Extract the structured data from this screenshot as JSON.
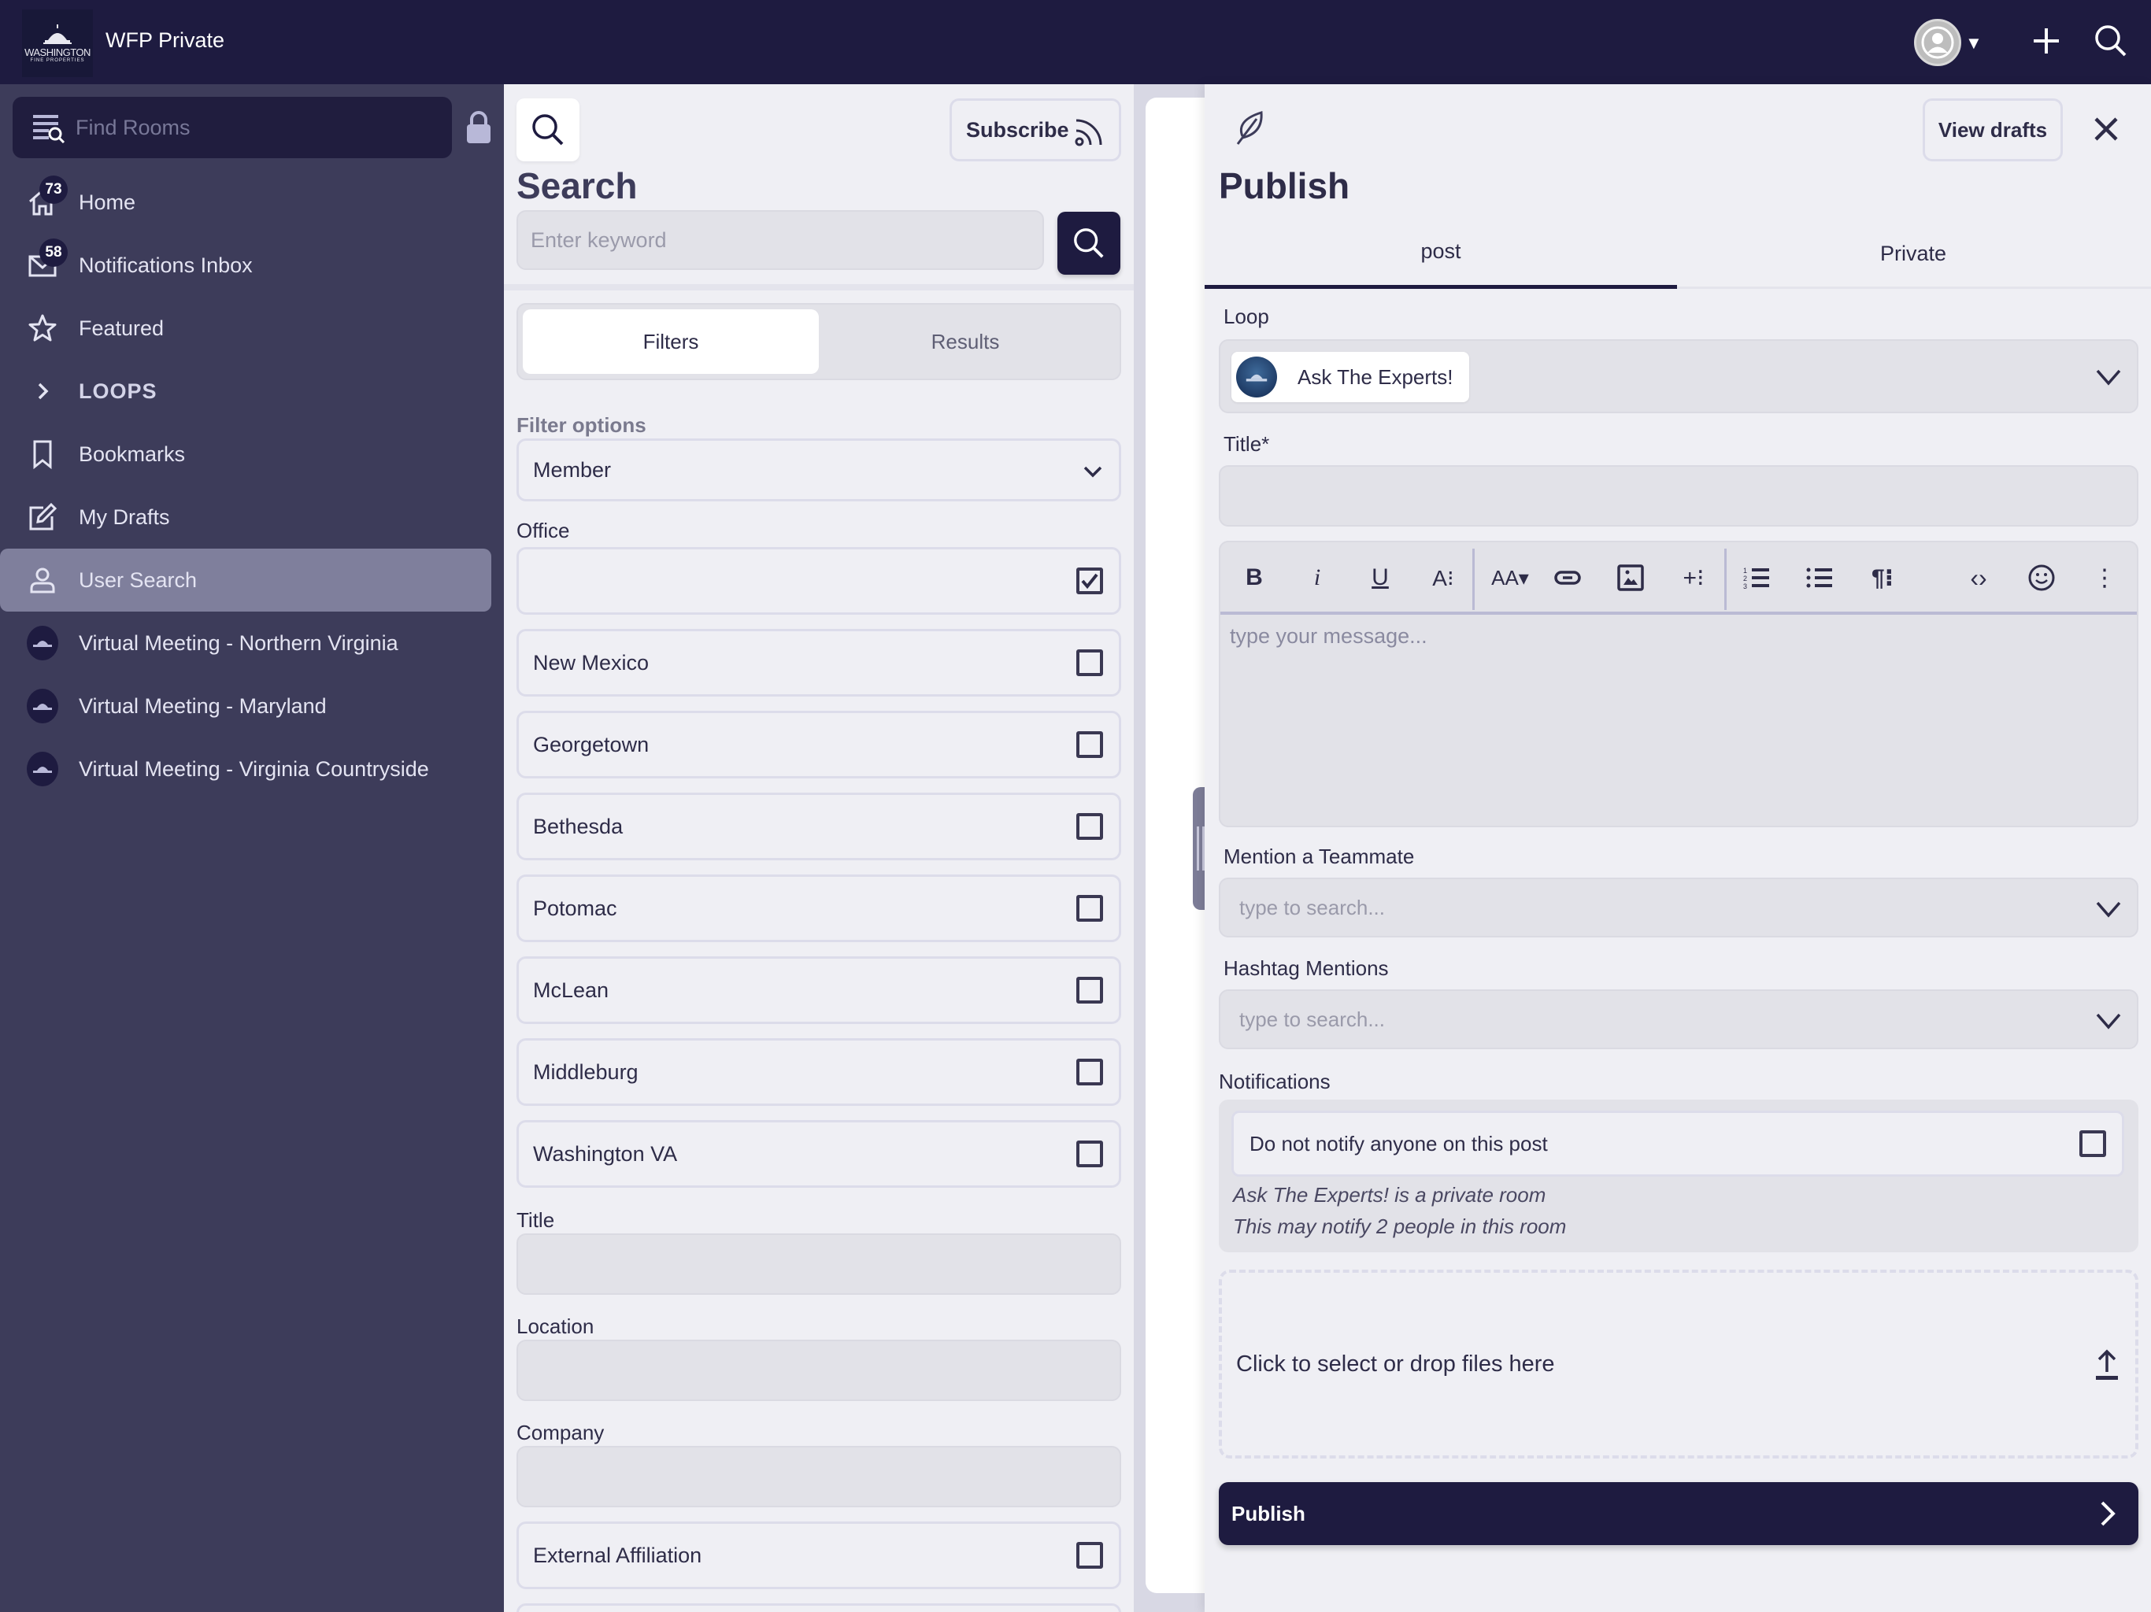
{
  "app": {
    "title": "WFP Private",
    "logo": {
      "line1": "WASHINGTON",
      "line2": "FINE PROPERTIES"
    },
    "actions": {
      "avatar": "user-avatar",
      "add": "plus-icon",
      "search": "search-icon"
    }
  },
  "sidebar": {
    "find_rooms_placeholder": "Find Rooms",
    "items": [
      {
        "label": "Home",
        "icon": "home-icon",
        "badge": "73"
      },
      {
        "label": "Notifications Inbox",
        "icon": "mail-icon",
        "badge": "58"
      },
      {
        "label": "Featured",
        "icon": "star-icon"
      },
      {
        "label": "LOOPS",
        "icon": "chevron-right-icon"
      },
      {
        "label": "Bookmarks",
        "icon": "bookmark-icon"
      },
      {
        "label": "My Drafts",
        "icon": "edit-icon"
      },
      {
        "label": "User Search",
        "icon": "user-icon",
        "active": true
      },
      {
        "label": "Virtual Meeting - Northern Virginia",
        "icon": "room-avatar"
      },
      {
        "label": "Virtual Meeting - Maryland",
        "icon": "room-avatar"
      },
      {
        "label": "Virtual Meeting - Virginia Countryside",
        "icon": "room-avatar"
      }
    ]
  },
  "search": {
    "subscribe_label": "Subscribe",
    "title": "Search",
    "keyword_placeholder": "Enter keyword",
    "keyword_value": "",
    "tabs": [
      {
        "label": "Filters",
        "active": true
      },
      {
        "label": "Results",
        "active": false
      }
    ],
    "filter_options_label": "Filter options",
    "filter_options_value": "Member",
    "office_label": "Office",
    "office_options": [
      {
        "label": "",
        "checked": true
      },
      {
        "label": "New Mexico",
        "checked": false
      },
      {
        "label": "Georgetown",
        "checked": false
      },
      {
        "label": "Bethesda",
        "checked": false
      },
      {
        "label": "Potomac",
        "checked": false
      },
      {
        "label": "McLean",
        "checked": false
      },
      {
        "label": "Middleburg",
        "checked": false
      },
      {
        "label": "Washington VA",
        "checked": false
      }
    ],
    "title_label": "Title",
    "title_value": "",
    "location_label": "Location",
    "location_value": "",
    "company_label": "Company",
    "company_value": "",
    "external_affiliation_label": "External Affiliation",
    "external_affiliation_checked": false
  },
  "publish": {
    "view_drafts_label": "View drafts",
    "title": "Publish",
    "tabs": [
      {
        "label": "post",
        "active": true
      },
      {
        "label": "Private",
        "active": false
      }
    ],
    "loop_label": "Loop",
    "loop_value": "Ask The Experts!",
    "title_label": "Title*",
    "title_value": "",
    "toolbar": [
      {
        "name": "bold",
        "glyph": "B"
      },
      {
        "name": "italic",
        "glyph": "i"
      },
      {
        "name": "underline",
        "glyph": "U"
      },
      {
        "name": "text-style",
        "glyph": "A⁝"
      },
      {
        "name": "font-size",
        "glyph": "AA▾"
      },
      {
        "name": "link",
        "glyph": "⊂⊃"
      },
      {
        "name": "image",
        "glyph": "▣"
      },
      {
        "name": "insert",
        "glyph": "+⁝"
      },
      {
        "name": "ordered-list",
        "glyph": "≡"
      },
      {
        "name": "bullet-list",
        "glyph": "☰"
      },
      {
        "name": "paragraph",
        "glyph": "¶⁝"
      },
      {
        "name": "code",
        "glyph": "‹›"
      },
      {
        "name": "emoji",
        "glyph": "☺"
      },
      {
        "name": "more",
        "glyph": "⋮"
      }
    ],
    "message_placeholder": "type your message...",
    "mention_label": "Mention a Teammate",
    "mention_placeholder": "type to search...",
    "hashtag_label": "Hashtag Mentions",
    "hashtag_placeholder": "type to search...",
    "notifications_label": "Notifications",
    "do_not_notify_label": "Do not notify anyone on this post",
    "do_not_notify_checked": false,
    "notes": [
      "Ask The Experts! is a private room",
      "This may notify 2 people in this room"
    ],
    "dropzone_label": "Click to select or drop files here",
    "publish_label": "Publish"
  },
  "colors": {
    "primary": "#1e1b40",
    "sidebar_bg": "#3d3c5a",
    "sidebar_active": "#7f7f9c",
    "panel_bg": "#efeff4",
    "input_bg": "#e2e2e8"
  }
}
